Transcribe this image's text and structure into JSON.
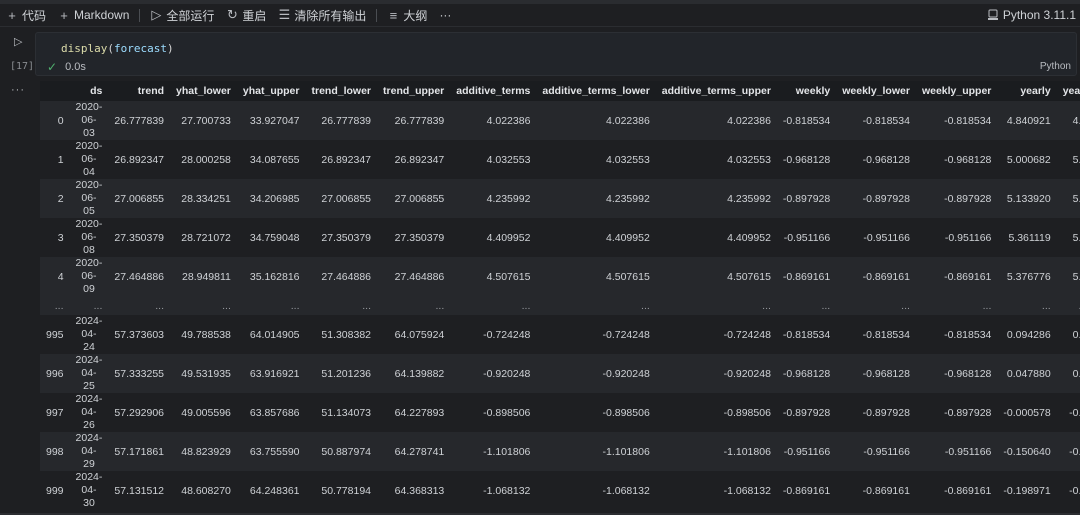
{
  "toolbar": {
    "code": "代码",
    "markdown": "Markdown",
    "run_all": "全部运行",
    "restart": "重启",
    "clear_outputs": "清除所有输出",
    "outline": "大纲",
    "more": "···",
    "kernel": "Python 3.11.1"
  },
  "cell": {
    "exec_count": "[17]",
    "code_fn": "display",
    "code_arg": "forecast",
    "duration": "0.0s",
    "language": "Python",
    "output_more": "···"
  },
  "table": {
    "columns": [
      "",
      "ds",
      "trend",
      "yhat_lower",
      "yhat_upper",
      "trend_lower",
      "trend_upper",
      "additive_terms",
      "additive_terms_lower",
      "additive_terms_upper",
      "weekly",
      "weekly_lower",
      "weekly_upper",
      "yearly",
      "yearl"
    ],
    "rows": [
      [
        "0",
        "2020-06-03",
        "26.777839",
        "27.700733",
        "33.927047",
        "26.777839",
        "26.777839",
        "4.022386",
        "4.022386",
        "4.022386",
        "-0.818534",
        "-0.818534",
        "-0.818534",
        "4.840921",
        "4.8"
      ],
      [
        "1",
        "2020-06-04",
        "26.892347",
        "28.000258",
        "34.087655",
        "26.892347",
        "26.892347",
        "4.032553",
        "4.032553",
        "4.032553",
        "-0.968128",
        "-0.968128",
        "-0.968128",
        "5.000682",
        "5.0"
      ],
      [
        "2",
        "2020-06-05",
        "27.006855",
        "28.334251",
        "34.206985",
        "27.006855",
        "27.006855",
        "4.235992",
        "4.235992",
        "4.235992",
        "-0.897928",
        "-0.897928",
        "-0.897928",
        "5.133920",
        "5.1"
      ],
      [
        "3",
        "2020-06-08",
        "27.350379",
        "28.721072",
        "34.759048",
        "27.350379",
        "27.350379",
        "4.409952",
        "4.409952",
        "4.409952",
        "-0.951166",
        "-0.951166",
        "-0.951166",
        "5.361119",
        "5.3"
      ],
      [
        "4",
        "2020-06-09",
        "27.464886",
        "28.949811",
        "35.162816",
        "27.464886",
        "27.464886",
        "4.507615",
        "4.507615",
        "4.507615",
        "-0.869161",
        "-0.869161",
        "-0.869161",
        "5.376776",
        "5.3"
      ],
      [
        "...",
        "...",
        "...",
        "...",
        "...",
        "...",
        "...",
        "...",
        "...",
        "...",
        "...",
        "...",
        "...",
        "...",
        "..."
      ],
      [
        "995",
        "2024-04-24",
        "57.373603",
        "49.788538",
        "64.014905",
        "51.308382",
        "64.075924",
        "-0.724248",
        "-0.724248",
        "-0.724248",
        "-0.818534",
        "-0.818534",
        "-0.818534",
        "0.094286",
        "0.0"
      ],
      [
        "996",
        "2024-04-25",
        "57.333255",
        "49.531935",
        "63.916921",
        "51.201236",
        "64.139882",
        "-0.920248",
        "-0.920248",
        "-0.920248",
        "-0.968128",
        "-0.968128",
        "-0.968128",
        "0.047880",
        "0.0"
      ],
      [
        "997",
        "2024-04-26",
        "57.292906",
        "49.005596",
        "63.857686",
        "51.134073",
        "64.227893",
        "-0.898506",
        "-0.898506",
        "-0.898506",
        "-0.897928",
        "-0.897928",
        "-0.897928",
        "-0.000578",
        "-0.0"
      ],
      [
        "998",
        "2024-04-29",
        "57.171861",
        "48.823929",
        "63.755590",
        "50.887974",
        "64.278741",
        "-1.101806",
        "-1.101806",
        "-1.101806",
        "-0.951166",
        "-0.951166",
        "-0.951166",
        "-0.150640",
        "-0.1"
      ],
      [
        "999",
        "2024-04-30",
        "57.131512",
        "48.608270",
        "64.248361",
        "50.778194",
        "64.368313",
        "-1.068132",
        "-1.068132",
        "-1.068132",
        "-0.869161",
        "-0.869161",
        "-0.869161",
        "-0.198971",
        "-0.1"
      ]
    ]
  }
}
